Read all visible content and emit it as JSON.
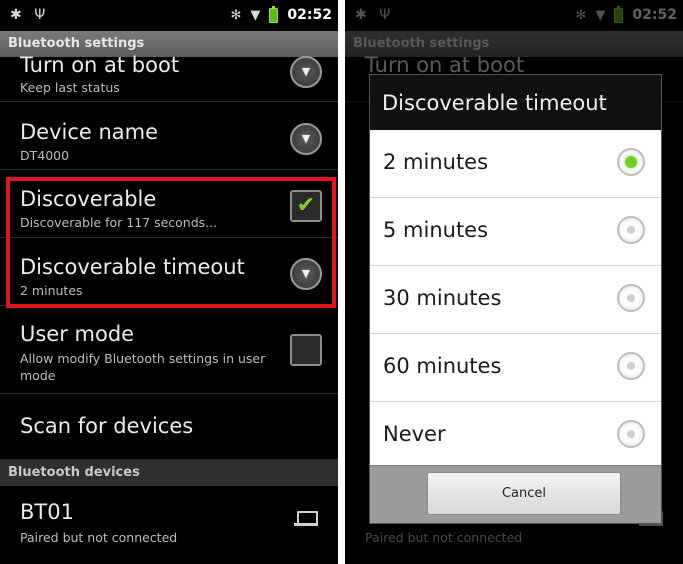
{
  "status_bar": {
    "time": "02:52",
    "icons": [
      "android-debug-icon",
      "usb-icon",
      "bluetooth-icon",
      "wifi-icon",
      "battery-icon"
    ]
  },
  "titlebar": {
    "title": "Bluetooth settings"
  },
  "prefs": [
    {
      "title": "Turn on at boot",
      "summary": "Keep last status",
      "widget": "dropdown"
    },
    {
      "title": "Device name",
      "summary": "DT4000",
      "widget": "dropdown"
    },
    {
      "title": "Discoverable",
      "summary": "Discoverable for 117 seconds...",
      "widget": "checkbox",
      "checked": true
    },
    {
      "title": "Discoverable timeout",
      "summary": "2 minutes",
      "widget": "dropdown"
    },
    {
      "title": "User mode",
      "summary": "Allow modify Bluetooth settings in user mode",
      "widget": "checkbox",
      "checked": false
    },
    {
      "title": "Scan for devices"
    }
  ],
  "devices_section": {
    "header": "Bluetooth devices"
  },
  "devices": [
    {
      "name": "BT01",
      "status": "Paired but not connected",
      "icon": "laptop-icon"
    }
  ],
  "dialog": {
    "title": "Discoverable timeout",
    "options": [
      {
        "label": "2 minutes",
        "selected": true
      },
      {
        "label": "5 minutes",
        "selected": false
      },
      {
        "label": "30 minutes",
        "selected": false
      },
      {
        "label": "60 minutes",
        "selected": false
      },
      {
        "label": "Never",
        "selected": false
      }
    ],
    "cancel_label": "Cancel"
  },
  "colors": {
    "highlight": "#e3161a",
    "check_green": "#7fd32a"
  }
}
